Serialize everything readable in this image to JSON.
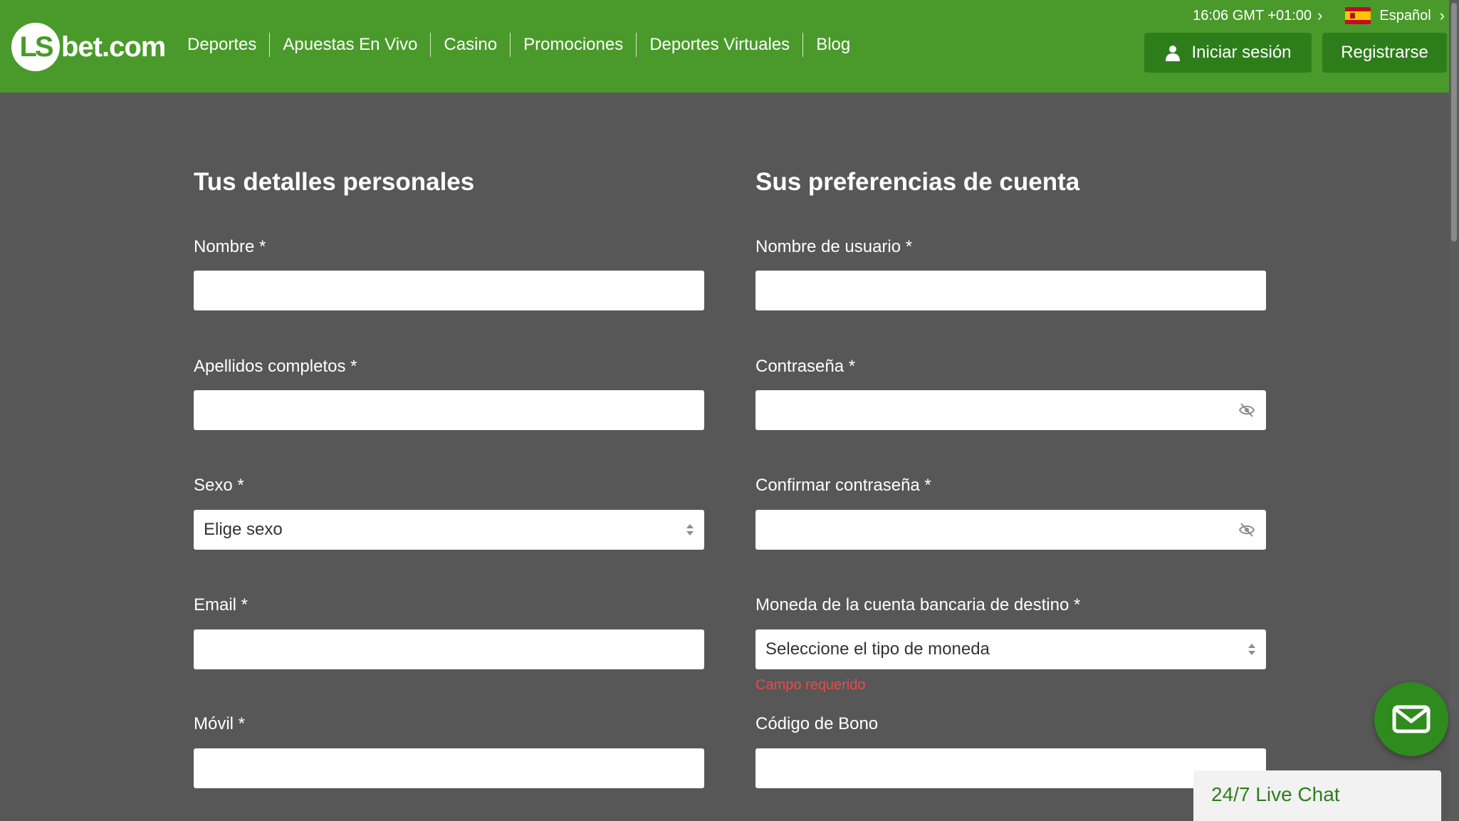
{
  "header": {
    "logo": {
      "mark": "LS",
      "text": "bet.com"
    },
    "nav": [
      "Deportes",
      "Apuestas En Vivo",
      "Casino",
      "Promociones",
      "Deportes Virtuales",
      "Blog"
    ],
    "time": "16:06 GMT +01:00",
    "language": "Español",
    "login_label": "Iniciar sesión",
    "register_label": "Registrarse",
    "brand_color": "#4a9a2b"
  },
  "personal": {
    "title": "Tus detalles personales",
    "first_name": {
      "label": "Nombre *",
      "value": ""
    },
    "last_name": {
      "label": "Apellidos completos *",
      "value": ""
    },
    "gender": {
      "label": "Sexo *",
      "selected": "Elige sexo"
    },
    "email": {
      "label": "Email *",
      "value": ""
    },
    "mobile": {
      "label": "Móvil *",
      "value": ""
    }
  },
  "account": {
    "title": "Sus preferencias de cuenta",
    "username": {
      "label": "Nombre de usuario *",
      "value": ""
    },
    "password": {
      "label": "Contraseña *",
      "value": ""
    },
    "confirm_password": {
      "label": "Confirmar contraseña *",
      "value": ""
    },
    "currency": {
      "label": "Moneda de la cuenta bancaria de destino *",
      "selected": "Seleccione el tipo de moneda",
      "error": "Campo requerido"
    },
    "bonus_code": {
      "label": "Código de Bono",
      "value": ""
    }
  },
  "chat": {
    "label": "24/7 Live Chat",
    "icon": "envelope-icon"
  }
}
